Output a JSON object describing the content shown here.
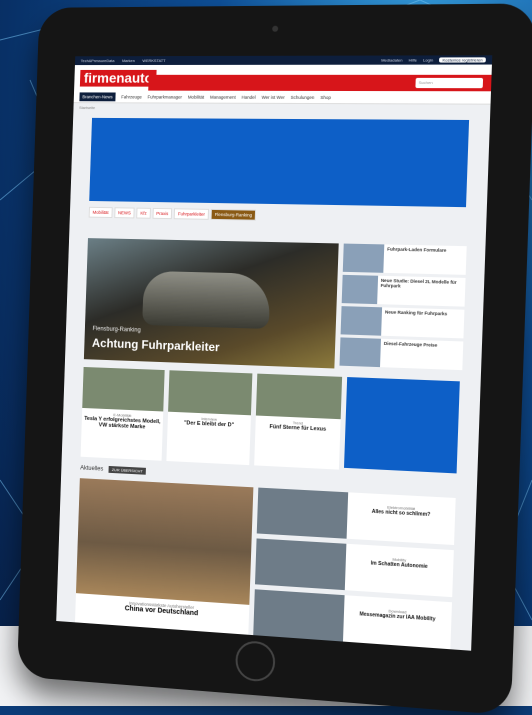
{
  "site": {
    "topbar_links": [
      "Tech&PressureData",
      "Marken",
      "WERKSTATT"
    ],
    "topbar_right": [
      "Mediadaten",
      "Hilfe",
      "Login",
      "Kostenlos registrieren"
    ],
    "logo": "firmenauto",
    "search_placeholder": "Suchen",
    "nav": [
      "Branchen-News",
      "Fahrzeuge",
      "Fuhrparkmanager",
      "Mobilität",
      "Management",
      "Handel",
      "Wer ist Wer",
      "Schulungen",
      "Shop"
    ],
    "breadcrumb": "Startseite"
  },
  "tabs": [
    "Mobilität",
    "NEWS",
    "Kfz",
    "Praxis",
    "Fuhrparkleiter",
    "Flensburg-Ranking"
  ],
  "hero": {
    "kicker": "Flensburg-Ranking",
    "title": "Achtung Fuhrparkleiter"
  },
  "side_items": [
    {
      "title": "Fuhrpark-Laden Formulare"
    },
    {
      "title": "Neue Studie: Diesel 2L Modelle für Fuhrpark"
    },
    {
      "title": "Neue Ranking für Fuhrparks"
    },
    {
      "title": "Diesel-Fahrzeuge Preise"
    }
  ],
  "cards": [
    {
      "kicker": "E-Mobilität",
      "title": "Tesla Y erfolgreichstes Modell, VW stärkste Marke"
    },
    {
      "kicker": "Interview",
      "title": "\"Der E bleibt der D\""
    },
    {
      "kicker": "Trend",
      "title": "Fünf Sterne für Lexus"
    }
  ],
  "section": {
    "title": "Aktuelles",
    "badge": "ZUR ÜBERSICHT"
  },
  "feature": {
    "kicker": "Innovationsstärkste Autohersteller",
    "title": "China vor Deutschland"
  },
  "list": [
    {
      "kicker": "Elektromobilität",
      "title": "Alles nicht so schlimm?"
    },
    {
      "kicker": "Mobility",
      "title": "Im Schatten Autonomie"
    },
    {
      "kicker": "Download",
      "title": "Messemagazin zur IAA Mobility"
    }
  ]
}
